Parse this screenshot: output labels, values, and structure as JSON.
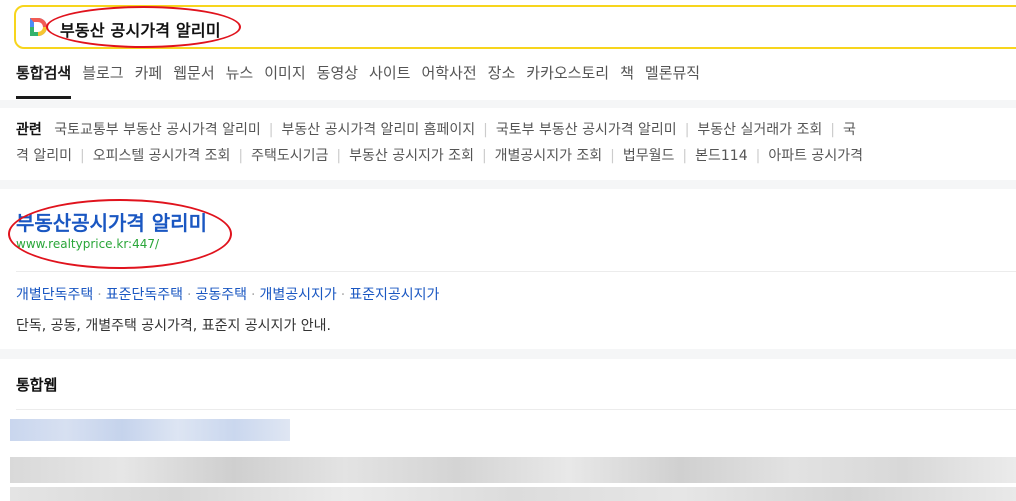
{
  "search": {
    "query": "부동산 공시가격 알리미"
  },
  "tabs": [
    {
      "label": "통합검색",
      "active": true
    },
    {
      "label": "블로그"
    },
    {
      "label": "카페"
    },
    {
      "label": "웹문서"
    },
    {
      "label": "뉴스"
    },
    {
      "label": "이미지"
    },
    {
      "label": "동영상"
    },
    {
      "label": "사이트"
    },
    {
      "label": "어학사전"
    },
    {
      "label": "장소"
    },
    {
      "label": "카카오스토리"
    },
    {
      "label": "책"
    },
    {
      "label": "멜론뮤직"
    }
  ],
  "related": {
    "title": "관련",
    "line1": [
      "국토교통부 부동산 공시가격 알리미",
      "부동산 공시가격 알리미 홈페이지",
      "국토부 부동산 공시가격 알리미",
      "부동산 실거래가 조회",
      "국"
    ],
    "line2": [
      "격 알리미",
      "오피스텔 공시가격 조회",
      "주택도시기금",
      "부동산 공시지가 조회",
      "개별공시지가 조회",
      "법무월드",
      "본드114",
      "아파트 공시가격"
    ]
  },
  "result": {
    "title": "부동산공시가격 알리미",
    "url": "www.realtyprice.kr:447/",
    "sublinks": [
      "개별단독주택",
      "표준단독주택",
      "공동주택",
      "개별공시지가",
      "표준지공시지가"
    ],
    "description": "단독, 공동, 개별주택 공시가격, 표준지 공시지가 안내."
  },
  "web": {
    "title": "통합웹"
  },
  "colors": {
    "search_border": "#f7d51d",
    "link_blue": "#1a57c2",
    "url_green": "#2aa639",
    "annotation_red": "#e0131d"
  }
}
